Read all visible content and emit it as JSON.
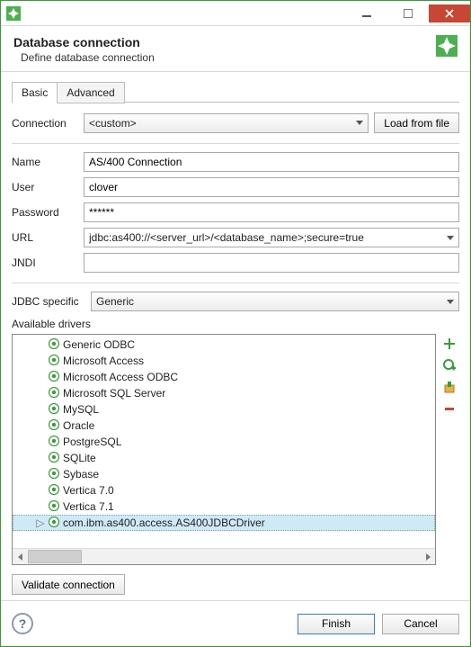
{
  "header": {
    "title": "Database connection",
    "subtitle": "Define database connection"
  },
  "tabs": {
    "basic": "Basic",
    "advanced": "Advanced"
  },
  "labels": {
    "connection": "Connection",
    "name": "Name",
    "user": "User",
    "password": "Password",
    "url": "URL",
    "jndi": "JNDI",
    "jdbc": "JDBC specific",
    "available": "Available drivers",
    "load": "Load from file",
    "validate": "Validate connection",
    "finish": "Finish",
    "cancel": "Cancel"
  },
  "values": {
    "connection": "<custom>",
    "name": "AS/400 Connection",
    "user": "clover",
    "password": "******",
    "url_prefix": "jdbc:as400://<server_url>/<database_name>",
    "url_suffix": ";secure=true",
    "jndi": "",
    "jdbc": "Generic"
  },
  "drivers": [
    "Generic ODBC",
    "Microsoft Access",
    "Microsoft Access ODBC",
    "Microsoft SQL Server",
    "MySQL",
    "Oracle",
    "PostgreSQL",
    "SQLite",
    "Sybase",
    "Vertica 7.0",
    "Vertica 7.1",
    "com.ibm.as400.access.AS400JDBCDriver"
  ],
  "selected_driver_index": 11
}
